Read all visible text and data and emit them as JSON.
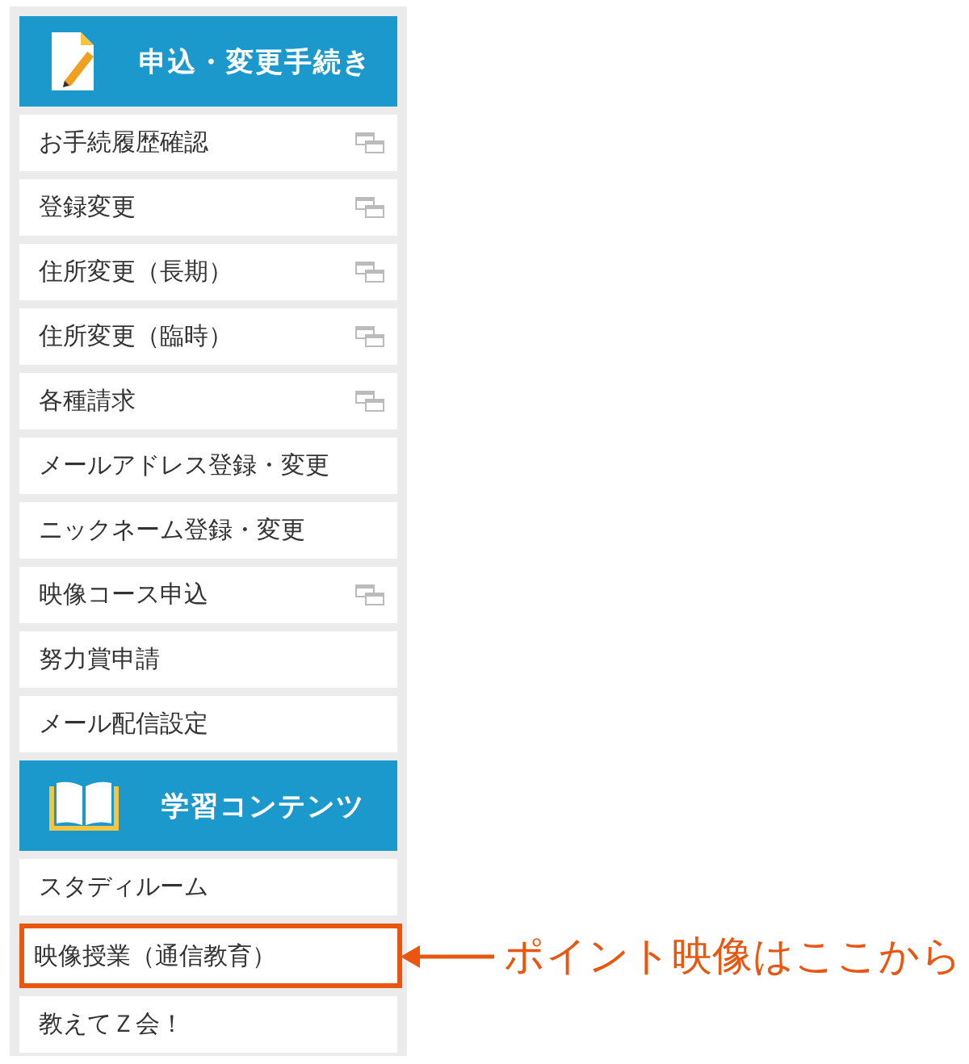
{
  "sections": [
    {
      "title": "申込・変更手続き",
      "kind": "document",
      "items": [
        {
          "label": "お手続履歴確認",
          "external": true,
          "highlighted": false
        },
        {
          "label": "登録変更",
          "external": true,
          "highlighted": false
        },
        {
          "label": "住所変更（長期）",
          "external": true,
          "highlighted": false
        },
        {
          "label": "住所変更（臨時）",
          "external": true,
          "highlighted": false
        },
        {
          "label": "各種請求",
          "external": true,
          "highlighted": false
        },
        {
          "label": "メールアドレス登録・変更",
          "external": false,
          "highlighted": false
        },
        {
          "label": "ニックネーム登録・変更",
          "external": false,
          "highlighted": false
        },
        {
          "label": "映像コース申込",
          "external": true,
          "highlighted": false
        },
        {
          "label": "努力賞申請",
          "external": false,
          "highlighted": false
        },
        {
          "label": "メール配信設定",
          "external": false,
          "highlighted": false
        }
      ]
    },
    {
      "title": "学習コンテンツ",
      "kind": "book",
      "items": [
        {
          "label": "スタディルーム",
          "external": false,
          "highlighted": false
        },
        {
          "label": "映像授業（通信教育）",
          "external": false,
          "highlighted": true
        },
        {
          "label": "教えてＺ会！",
          "external": false,
          "highlighted": false
        }
      ]
    }
  ],
  "annotation": {
    "text": "ポイント映像はここから"
  }
}
